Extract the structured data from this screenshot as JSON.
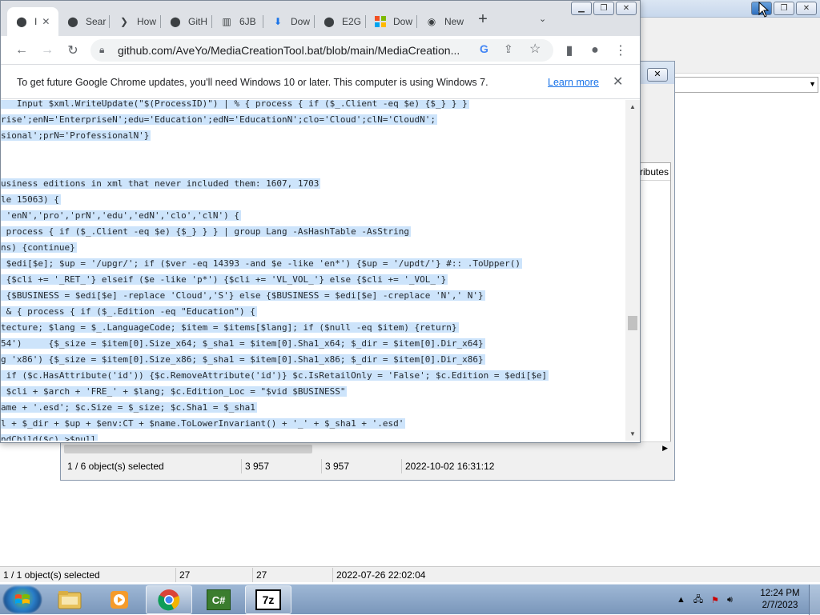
{
  "bg_window": {
    "combo_arrow": "▼",
    "status": {
      "selected": "1 / 1 object(s) selected",
      "size": "27",
      "packed": "27",
      "modified": "2022-07-26 22:02:04"
    }
  },
  "inner_window": {
    "close": "✕",
    "combo_arrow": "▼",
    "column_header": "ributes",
    "status": {
      "selected": "1 / 6 object(s) selected",
      "size": "3 957",
      "packed": "3 957",
      "modified": "2022-10-02 16:31:12"
    }
  },
  "chrome": {
    "tabs": [
      {
        "label": "I",
        "icon": "github-icon",
        "active": true
      },
      {
        "label": "Sear",
        "icon": "github-icon"
      },
      {
        "label": "How",
        "icon": "chevron-icon"
      },
      {
        "label": "GitH",
        "icon": "github-icon"
      },
      {
        "label": "6JB",
        "icon": "library-icon"
      },
      {
        "label": "Dow",
        "icon": "download-icon"
      },
      {
        "label": "E2G",
        "icon": "github-icon"
      },
      {
        "label": "Dow",
        "icon": "microsoft-icon"
      },
      {
        "label": "New",
        "icon": "chrome-icon"
      }
    ],
    "new_tab": "+",
    "url": "github.com/AveYo/MediaCreationTool.bat/blob/main/MediaCreation...",
    "infobar": {
      "message": "To get future Google Chrome updates, you'll need Windows 10 or later. This computer is using Windows 7.",
      "learn_more": "Learn more"
    },
    "code_lines": [
      "   Input $xml.WriteUpdate(\"$(ProcessID)\") | % { process { if ($_.Client -eq $e) {$_} } }",
      "rise';enN='EnterpriseN';edu='Education';edN='EducationN';clo='Cloud';clN='CloudN';",
      "sional';prN='ProfessionalN'}",
      "",
      "",
      "usiness editions in xml that never included them: 1607, 1703",
      "le 15063) {",
      " 'enN','pro','prN','edu','edN','clo','clN') {",
      " process { if ($_.Client -eq $e) {$_} } } | group Lang -AsHashTable -AsString",
      "ns) {continue}",
      " $edi[$e]; $up = '/upgr/'; if ($ver -eq 14393 -and $e -like 'en*') {$up = '/updt/'} #:: .ToUpper()",
      " {$cli += '_RET_'} elseif ($e -like 'p*') {$cli += 'VL_VOL_'} else {$cli += '_VOL_'}",
      " {$BUSINESS = $edi[$e] -replace 'Cloud','S'} else {$BUSINESS = $edi[$e] -creplace 'N',' N'}",
      " & { process { if ($_.Edition -eq \"Education\") {",
      "tecture; $lang = $_.LanguageCode; $item = $items[$lang]; if ($null -eq $item) {return}",
      "54')     {$_size = $item[0].Size_x64; $_sha1 = $item[0].Sha1_x64; $_dir = $item[0].Dir_x64}",
      "g 'x86') {$_size = $item[0].Size_x86; $_sha1 = $item[0].Sha1_x86; $_dir = $item[0].Dir_x86}",
      " if ($c.HasAttribute('id')) {$c.RemoveAttribute('id')} $c.IsRetailOnly = 'False'; $c.Edition = $edi[$e]",
      " $cli + $arch + 'FRE_' + $lang; $c.Edition_Loc = \"$vid $BUSINESS\"",
      "ame + '.esd'; $c.Size = $_size; $c.Sha1 = $_sha1",
      "l + $_dir + $up + $env:CT + $name.ToLowerInvariant() + '_' + $_sha1 + '.esd'",
      "ndChild($c) >$null"
    ]
  },
  "taskbar": {
    "apps": [
      {
        "name": "explorer",
        "icon": "folder-icon"
      },
      {
        "name": "media",
        "icon": "media-player-icon"
      },
      {
        "name": "chrome",
        "icon": "chrome-icon",
        "active": true
      },
      {
        "name": "csharp",
        "icon": "csharp-icon",
        "label": "C#"
      },
      {
        "name": "7zip",
        "icon": "7zip-icon",
        "label": "7z"
      }
    ],
    "clock": {
      "time": "12:24 PM",
      "date": "2/7/2023"
    }
  },
  "colors": {
    "selection": "#cde4fb",
    "link": "#1a73e8",
    "taskbar": "#7a96ba"
  }
}
